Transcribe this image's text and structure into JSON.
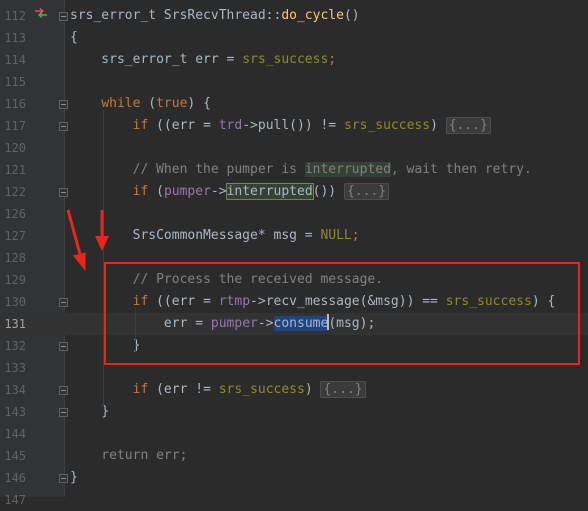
{
  "editor": {
    "lines": [
      {
        "n": "112",
        "tokens": [
          {
            "t": "srs_error_t SrsRecvThread::",
            "c": ""
          },
          {
            "t": "do_cycle",
            "c": "fn"
          },
          {
            "t": "()",
            "c": ""
          }
        ]
      },
      {
        "n": "113",
        "tokens": [
          {
            "t": "{",
            "c": ""
          }
        ]
      },
      {
        "n": "114",
        "tokens": [
          {
            "t": "    srs_error_t err = ",
            "c": ""
          },
          {
            "t": "srs_success",
            "c": "mac"
          },
          {
            "t": ";",
            "c": "kw"
          }
        ]
      },
      {
        "n": "115",
        "tokens": []
      },
      {
        "n": "116",
        "tokens": [
          {
            "t": "    ",
            "c": ""
          },
          {
            "t": "while",
            "c": "kw"
          },
          {
            "t": " (",
            "c": ""
          },
          {
            "t": "true",
            "c": "kw"
          },
          {
            "t": ") {",
            "c": ""
          }
        ]
      },
      {
        "n": "117",
        "tokens": [
          {
            "t": "        ",
            "c": ""
          },
          {
            "t": "if",
            "c": "kw"
          },
          {
            "t": " ((err = ",
            "c": ""
          },
          {
            "t": "trd",
            "c": "var"
          },
          {
            "t": "->pull()) != ",
            "c": ""
          },
          {
            "t": "srs_success",
            "c": "mac"
          },
          {
            "t": ") ",
            "c": ""
          },
          {
            "t": "{...}",
            "c": "fold-ph"
          }
        ]
      },
      {
        "n": "120",
        "tokens": []
      },
      {
        "n": "121",
        "tokens": [
          {
            "t": "        // When the pumper is ",
            "c": "cm"
          },
          {
            "t": "interrupted",
            "c": "cm hl-green"
          },
          {
            "t": ", wait then retry.",
            "c": "cm"
          }
        ]
      },
      {
        "n": "122",
        "tokens": [
          {
            "t": "        ",
            "c": ""
          },
          {
            "t": "if",
            "c": "kw"
          },
          {
            "t": " (",
            "c": ""
          },
          {
            "t": "pumper",
            "c": "var"
          },
          {
            "t": "->",
            "c": ""
          },
          {
            "t": "interrupted",
            "c": "hl-green-box"
          },
          {
            "t": "()) ",
            "c": ""
          },
          {
            "t": "{...}",
            "c": "fold-ph"
          }
        ]
      },
      {
        "n": "126",
        "tokens": []
      },
      {
        "n": "127",
        "tokens": [
          {
            "t": "        SrsCommonMessage* msg = ",
            "c": ""
          },
          {
            "t": "NULL",
            "c": "mac"
          },
          {
            "t": ";",
            "c": "kw"
          }
        ]
      },
      {
        "n": "128",
        "tokens": []
      },
      {
        "n": "129",
        "tokens": [
          {
            "t": "        // Process the received message.",
            "c": "cm"
          }
        ]
      },
      {
        "n": "130",
        "tokens": [
          {
            "t": "        ",
            "c": ""
          },
          {
            "t": "if",
            "c": "kw"
          },
          {
            "t": " ((err = ",
            "c": ""
          },
          {
            "t": "rtmp",
            "c": "var"
          },
          {
            "t": "->recv_message(&msg)) == ",
            "c": ""
          },
          {
            "t": "srs_success",
            "c": "mac"
          },
          {
            "t": ") {",
            "c": ""
          }
        ]
      },
      {
        "n": "131",
        "tokens": [
          {
            "t": "            err = ",
            "c": ""
          },
          {
            "t": "pumper",
            "c": "var"
          },
          {
            "t": "->",
            "c": ""
          },
          {
            "t": "consume",
            "c": "hl-blue caret-after"
          },
          {
            "t": "(msg);",
            "c": ""
          }
        ],
        "current": true
      },
      {
        "n": "132",
        "tokens": [
          {
            "t": "        }",
            "c": ""
          }
        ]
      },
      {
        "n": "133",
        "tokens": []
      },
      {
        "n": "134",
        "tokens": [
          {
            "t": "        ",
            "c": ""
          },
          {
            "t": "if",
            "c": "kw"
          },
          {
            "t": " (err != ",
            "c": ""
          },
          {
            "t": "srs_success",
            "c": "mac"
          },
          {
            "t": ") ",
            "c": ""
          },
          {
            "t": "{...}",
            "c": "fold-ph"
          }
        ]
      },
      {
        "n": "143",
        "tokens": [
          {
            "t": "    }",
            "c": ""
          }
        ]
      },
      {
        "n": "144",
        "tokens": []
      },
      {
        "n": "145",
        "tokens": [
          {
            "t": "    return err;",
            "c": "cm"
          }
        ]
      },
      {
        "n": "146",
        "tokens": [
          {
            "t": "}",
            "c": ""
          }
        ]
      },
      {
        "n": "147",
        "tokens": []
      }
    ]
  },
  "colors": {
    "background": "#2b2b2b",
    "gutter": "#313335",
    "annotation": "#e8261d"
  },
  "icons": [
    "implementation-arrow-icon",
    "fold-marker-icon",
    "red-arrow-icon"
  ]
}
